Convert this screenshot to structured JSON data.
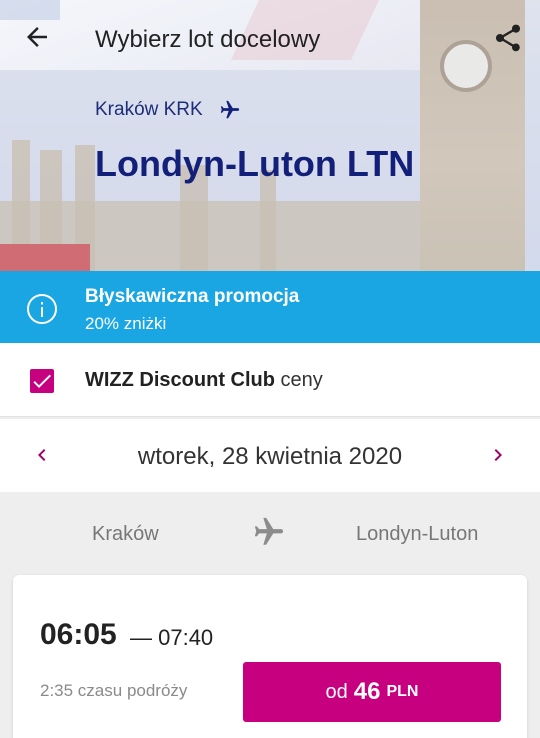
{
  "header": {
    "title": "Wybierz lot docelowy",
    "icons": {
      "back": "arrow-left-icon",
      "share": "share-icon"
    }
  },
  "hero": {
    "origin": "Kraków KRK",
    "destination": "Londyn-Luton LTN"
  },
  "promo": {
    "title": "Błyskawiczna promocja",
    "subtitle": "20% zniżki",
    "icon": "info-icon",
    "color": "#1aa5e3"
  },
  "discount_club": {
    "checked": true,
    "brand": "WIZZ Discount Club",
    "suffix": "ceny",
    "color": "#c6007e"
  },
  "date_bar": {
    "date": "wtorek, 28 kwietnia 2020"
  },
  "route": {
    "from": "Kraków",
    "to": "Londyn-Luton"
  },
  "flight": {
    "departure": "06:05",
    "arrival": "— 07:40",
    "duration": "2:35 czasu podróży",
    "price_prefix": "od",
    "price_value": "46",
    "price_currency": "PLN"
  }
}
